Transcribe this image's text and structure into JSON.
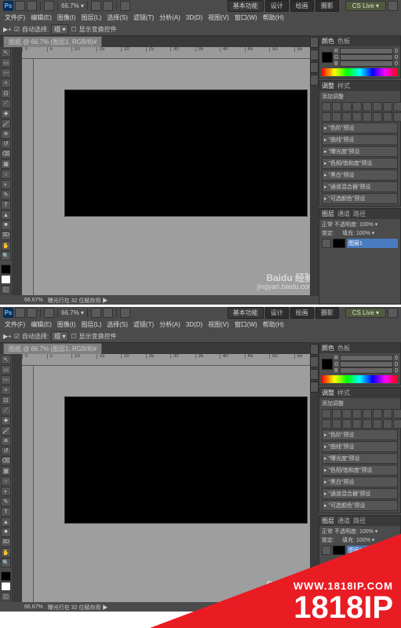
{
  "app": {
    "logo_text": "Ps",
    "zoom_level": "66.7",
    "zoom_suffix": "▾"
  },
  "top_buttons": {
    "essentials": "基本功能",
    "design": "设计",
    "paint": "绘画",
    "photo": "摄影",
    "cs_live": "CS Live ▾"
  },
  "menu": {
    "file": "文件(F)",
    "edit": "编辑(E)",
    "image": "图像(I)",
    "layer": "图层(L)",
    "select": "选择(S)",
    "filter": "滤镜(T)",
    "analysis": "分析(A)",
    "threeD": "3D(D)",
    "view": "视图(V)",
    "window": "窗口(W)",
    "help": "帮助(H)"
  },
  "options": {
    "tool_icon": "▶+",
    "auto_select_label": "自动选择:",
    "auto_select_value": "组 ▾",
    "show_transform": "显示变换控件",
    "alignA": "⊞",
    "alignB": "⊟"
  },
  "tab": {
    "title": "图纸 @ 66.7% (图层1, RGB/8)#"
  },
  "ruler_marks": [
    "0",
    "5",
    "10",
    "15",
    "20",
    "25",
    "30",
    "35",
    "40",
    "45",
    "50",
    "55"
  ],
  "watermark": {
    "brand_cn": "Baidu 经验",
    "url": "jingyan.baidu.com"
  },
  "status": {
    "zoom": "66.67%",
    "note": "曝光行在 32 位赋存用 ▶"
  },
  "panel_color": {
    "tab1": "颜色",
    "tab2": "色板",
    "r": "R",
    "g": "G",
    "b": "B",
    "rv": "0",
    "gv": "0",
    "bv": "0"
  },
  "panel_adjust": {
    "tab1": "调整",
    "tab2": "样式",
    "title": "添加调整",
    "presets": [
      "\"色阶\"预设",
      "\"曲线\"预设",
      "\"曝光度\"预设",
      "\"色相/饱和度\"预设",
      "\"黑白\"预设",
      "\"通道混合器\"预设",
      "\"可选颜色\"预设"
    ]
  },
  "panel_layers": {
    "tab1": "图层",
    "tab2": "通道",
    "tab3": "路径",
    "mode": "正常",
    "opacity_label": "不透明度:",
    "opacity_value": "100% ▾",
    "lock_label": "锁定:",
    "fill_label": "填充:",
    "fill_value": "100% ▾",
    "layer_name": "图层1"
  },
  "brand": {
    "url": "WWW.1818IP.COM",
    "name": "1818IP"
  }
}
